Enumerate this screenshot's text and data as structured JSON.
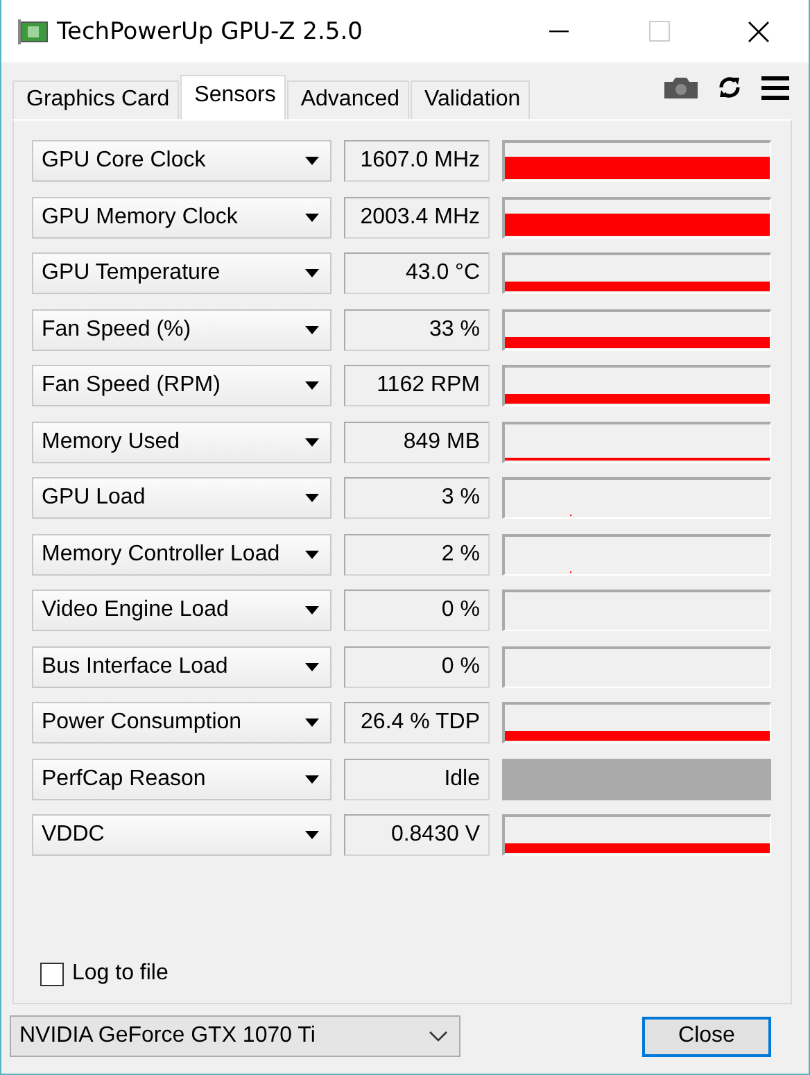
{
  "window": {
    "title": "TechPowerUp GPU-Z 2.5.0"
  },
  "tabs": [
    {
      "label": "Graphics Card",
      "selected": false
    },
    {
      "label": "Sensors",
      "selected": true
    },
    {
      "label": "Advanced",
      "selected": false
    },
    {
      "label": "Validation",
      "selected": false
    }
  ],
  "sensors": [
    {
      "name": "GPU Core Clock",
      "value": "1607.0 MHz",
      "kind": "graph"
    },
    {
      "name": "GPU Memory Clock",
      "value": "2003.4 MHz",
      "kind": "graph"
    },
    {
      "name": "GPU Temperature",
      "value": "43.0 °C",
      "kind": "graph"
    },
    {
      "name": "Fan Speed (%)",
      "value": "33 %",
      "kind": "graph"
    },
    {
      "name": "Fan Speed (RPM)",
      "value": "1162 RPM",
      "kind": "graph"
    },
    {
      "name": "Memory Used",
      "value": "849 MB",
      "kind": "graph"
    },
    {
      "name": "GPU Load",
      "value": "3 %",
      "kind": "graph"
    },
    {
      "name": "Memory Controller Load",
      "value": "2 %",
      "kind": "graph"
    },
    {
      "name": "Video Engine Load",
      "value": "0 %",
      "kind": "graph"
    },
    {
      "name": "Bus Interface Load",
      "value": "0 %",
      "kind": "graph"
    },
    {
      "name": "Power Consumption",
      "value": "26.4 % TDP",
      "kind": "graph"
    },
    {
      "name": "PerfCap Reason",
      "value": "Idle",
      "kind": "state"
    },
    {
      "name": "VDDC",
      "value": "0.8430 V",
      "kind": "graph"
    }
  ],
  "log_to_file": {
    "label": "Log to file",
    "checked": false
  },
  "gpu_select": {
    "value": "NVIDIA GeForce GTX 1070 Ti"
  },
  "buttons": [
    "Close"
  ]
}
